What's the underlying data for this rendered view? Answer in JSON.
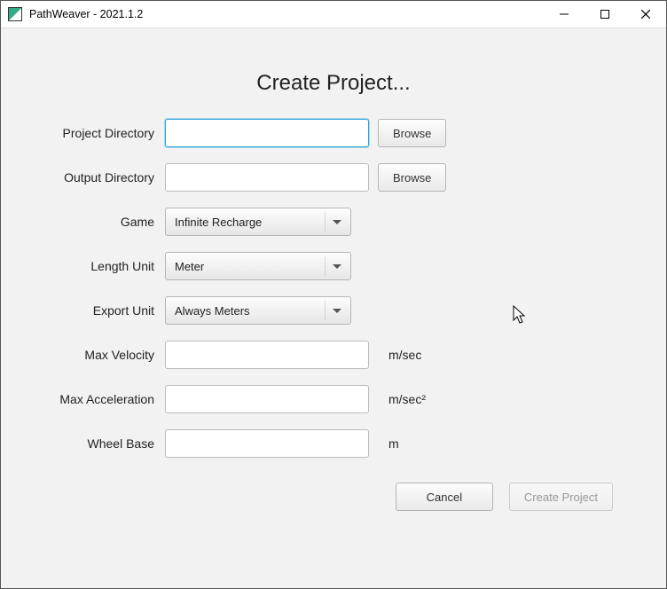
{
  "window": {
    "title": "PathWeaver - 2021.1.2"
  },
  "page": {
    "heading": "Create Project..."
  },
  "labels": {
    "projectDirectory": "Project Directory",
    "outputDirectory": "Output Directory",
    "game": "Game",
    "lengthUnit": "Length Unit",
    "exportUnit": "Export Unit",
    "maxVelocity": "Max Velocity",
    "maxAcceleration": "Max Acceleration",
    "wheelBase": "Wheel Base"
  },
  "fields": {
    "projectDirectory": "",
    "outputDirectory": "",
    "game": "Infinite Recharge",
    "lengthUnit": "Meter",
    "exportUnit": "Always Meters",
    "maxVelocity": "",
    "maxAcceleration": "",
    "wheelBase": ""
  },
  "units": {
    "maxVelocity": "m/sec",
    "maxAcceleration": "m/sec²",
    "wheelBase": "m"
  },
  "buttons": {
    "browse": "Browse",
    "cancel": "Cancel",
    "createProject": "Create Project"
  }
}
